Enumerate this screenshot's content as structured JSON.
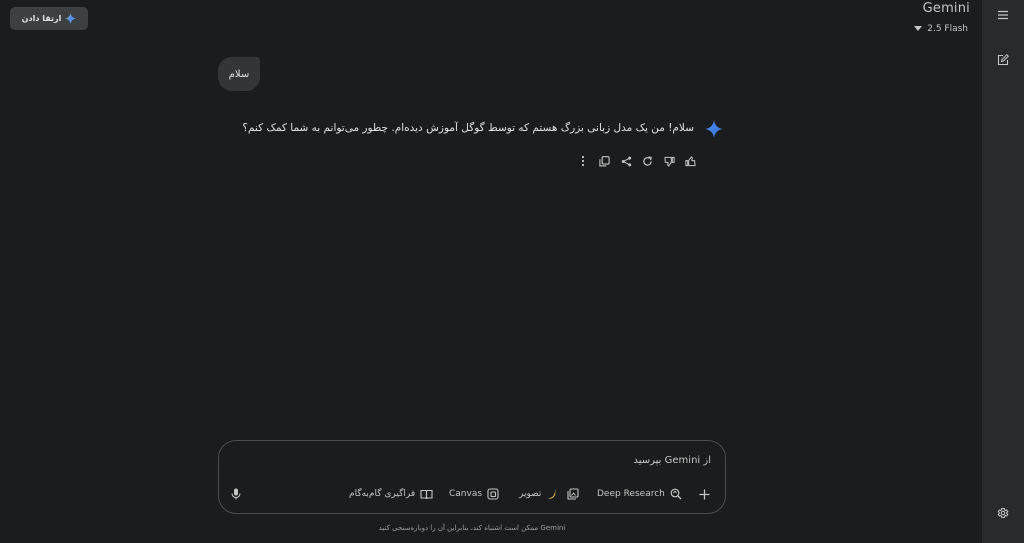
{
  "header": {
    "upgrade_label": "ارتقا دادن",
    "brand": "Gemini",
    "model": "2.5 Flash"
  },
  "conversation": {
    "user_message": "سلام",
    "response": "سلام! من یک مدل زبانی بزرگ هستم که توسط گوگل آموزش دیده‌ام. چطور می‌توانم به شما کمک کنم؟"
  },
  "composer": {
    "placeholder": "از Gemini بپرسید",
    "tools": {
      "deep_research": "Deep Research",
      "image": "تصویر",
      "canvas": "Canvas",
      "guided_learning": "فراگیری گام‌به‌گام"
    }
  },
  "footer": {
    "disclaimer": "Gemini ممکن است اشتباه کند، بنابراین آن را دوباره‌سنجی کنید"
  },
  "colors": {
    "background": "#1b1c1d",
    "rail": "#282a2c",
    "accent": "#4c8df6"
  }
}
